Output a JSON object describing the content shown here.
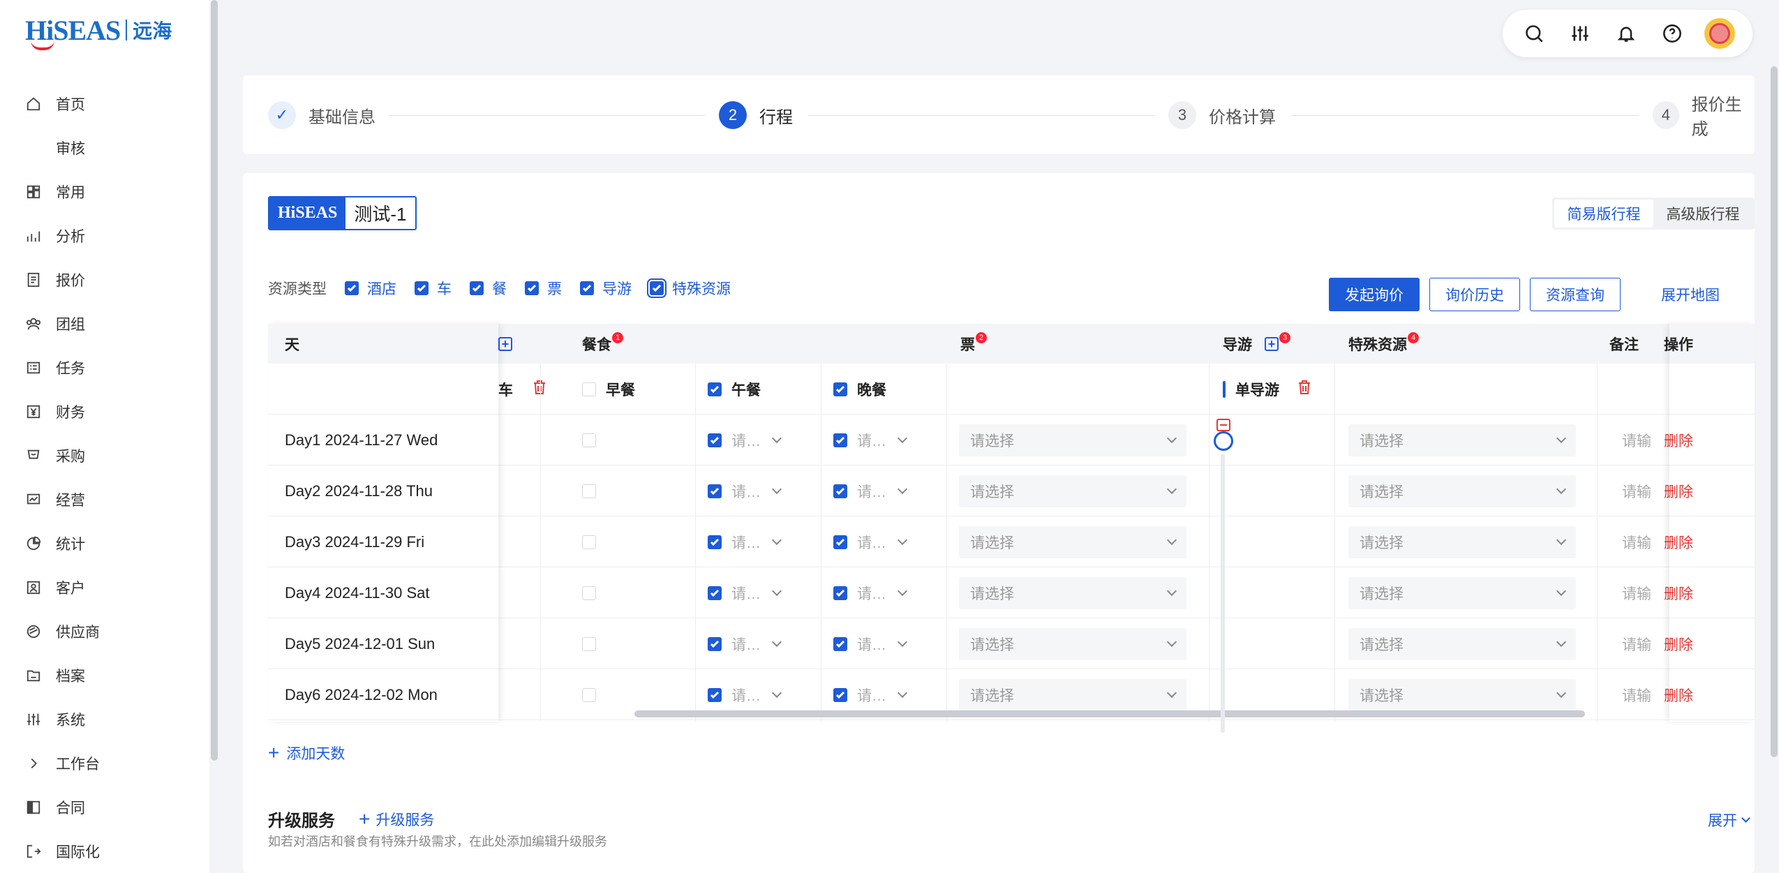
{
  "logo": {
    "brand": "HiSEAS",
    "cn": "远海"
  },
  "nav": [
    {
      "label": "首页",
      "icon": "home-icon"
    },
    {
      "label": "审核",
      "icon": ""
    },
    {
      "label": "常用",
      "icon": "grid-icon"
    },
    {
      "label": "分析",
      "icon": "chart-icon"
    },
    {
      "label": "报价",
      "icon": "doc-icon"
    },
    {
      "label": "团组",
      "icon": "team-icon"
    },
    {
      "label": "任务",
      "icon": "task-icon"
    },
    {
      "label": "财务",
      "icon": "yen-icon"
    },
    {
      "label": "采购",
      "icon": "cart-icon"
    },
    {
      "label": "经营",
      "icon": "trend-icon"
    },
    {
      "label": "统计",
      "icon": "pie-icon"
    },
    {
      "label": "客户",
      "icon": "customer-icon"
    },
    {
      "label": "供应商",
      "icon": "supplier-icon"
    },
    {
      "label": "档案",
      "icon": "folder-icon"
    },
    {
      "label": "系统",
      "icon": "sliders-icon"
    },
    {
      "label": "工作台",
      "icon": "chevron-right-icon"
    },
    {
      "label": "合同",
      "icon": "contract-icon"
    },
    {
      "label": "国际化",
      "icon": "logout-icon"
    }
  ],
  "steps": [
    {
      "num": "✓",
      "label": "基础信息",
      "state": "done"
    },
    {
      "num": "2",
      "label": "行程",
      "state": "active"
    },
    {
      "num": "3",
      "label": "价格计算",
      "state": "todo"
    },
    {
      "num": "4",
      "label": "报价生成",
      "state": "todo"
    }
  ],
  "tag": {
    "brand": "HiSEAS",
    "name": "测试-1"
  },
  "view_toggle": {
    "simple": "简易版行程",
    "advanced": "高级版行程"
  },
  "resource_type": {
    "label": "资源类型",
    "items": [
      "酒店",
      "车",
      "餐",
      "票",
      "导游",
      "特殊资源"
    ]
  },
  "actions": {
    "inquiry": "发起询价",
    "history": "询价历史",
    "query": "资源查询",
    "map": "展开地图"
  },
  "table": {
    "headers": {
      "day": "天",
      "meal": "餐食",
      "meal_badge": "1",
      "ticket": "票",
      "ticket_badge": "2",
      "guide": "导游",
      "guide_badge": "3",
      "special": "特殊资源",
      "special_badge": "4",
      "remark": "备注",
      "op": "操作"
    },
    "sub": {
      "car": "车",
      "breakfast": "早餐",
      "lunch": "午餐",
      "dinner": "晚餐",
      "guide": "单导游"
    },
    "placeholder": "请选择",
    "placeholder_short": "请…",
    "remark_placeholder": "请输",
    "delete": "删除",
    "days": [
      "Day1 2024-11-27 Wed",
      "Day2 2024-11-28 Thu",
      "Day3 2024-11-29 Fri",
      "Day4 2024-11-30 Sat",
      "Day5 2024-12-01 Sun",
      "Day6 2024-12-02 Mon"
    ]
  },
  "add_day": "添加天数",
  "upgrade": {
    "title": "升级服务",
    "add": "升级服务",
    "desc": "如若对酒店和餐食有特殊升级需求，在此处添加编辑升级服务",
    "expand": "展开"
  },
  "colors": {
    "primary": "#1d5bd8",
    "danger": "#e53935"
  }
}
